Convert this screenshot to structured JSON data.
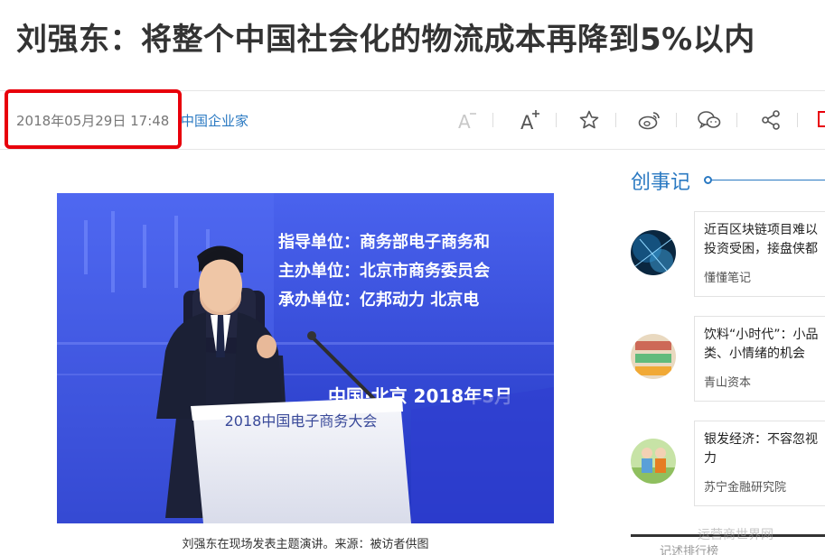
{
  "article": {
    "title": "刘强东：将整个中国社会化的物流成本再降到5%以内",
    "date": "2018年05月29日 17:48",
    "source": "中国企业家",
    "caption": "刘强东在现场发表主题演讲。来源：被访者供图"
  },
  "toolbar": {
    "icons": [
      "font-decrease-icon",
      "font-increase-icon",
      "star-icon",
      "weibo-icon",
      "wechat-icon",
      "share-icon"
    ]
  },
  "photo": {
    "banner_lines": [
      "指导单位：商务部电子商务和",
      "主办单位：北京市商务委员会",
      "承办单位：亿邦动力  北京电"
    ],
    "date_line": "中国·北京   2018年5月",
    "podium_text": "2018中国电子商务大会"
  },
  "sidebar": {
    "heading": "创事记",
    "cards": [
      {
        "title": "近百区块链项目难以\n投资受困，接盘侠都",
        "author": "懂懂笔记"
      },
      {
        "title": "饮料“小时代”：小品\n类、小情绪的机会",
        "author": "青山资本"
      },
      {
        "title": "银发经济：不容忽视\n力",
        "author": "苏宁金融研究院"
      }
    ],
    "bottom_label": "记述排行榜"
  },
  "watermark": "运营商世界网",
  "colors": {
    "accent_blue": "#2a79c2",
    "highlight_red": "#e8000b"
  }
}
